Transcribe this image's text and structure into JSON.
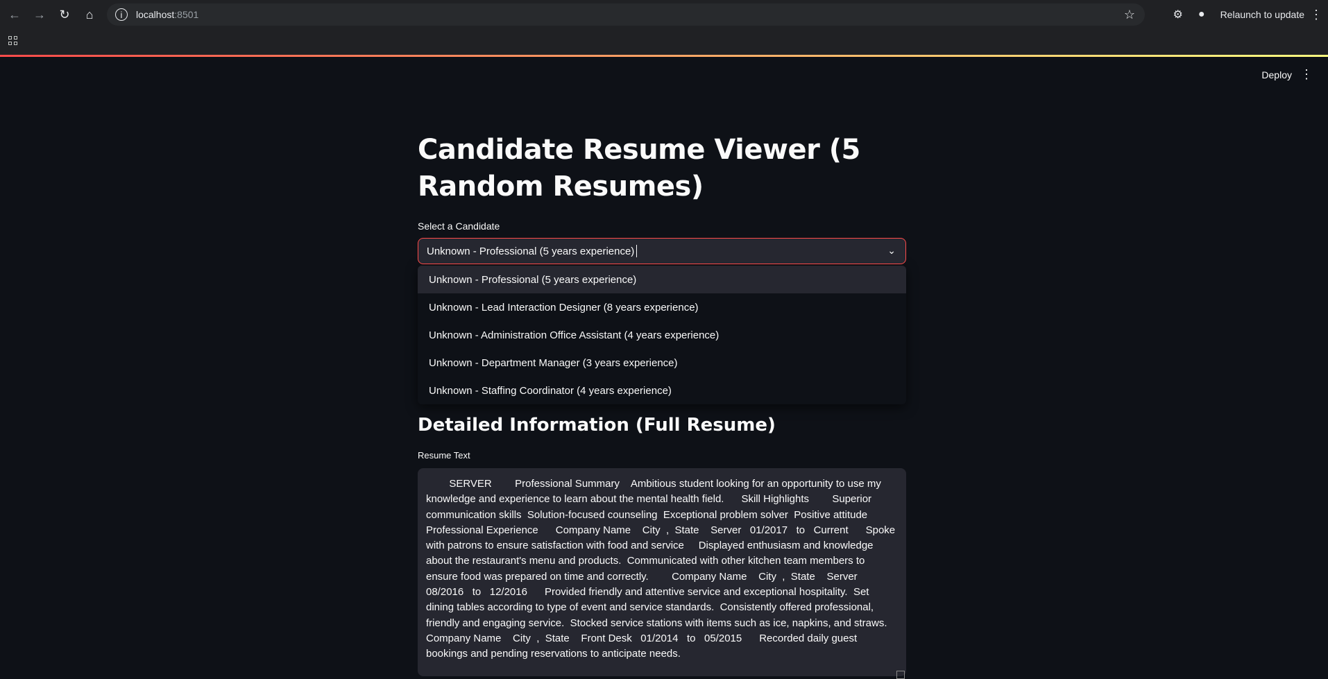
{
  "browser": {
    "url_host": "localhost",
    "url_port": ":8501",
    "relaunch_label": "Relaunch to update"
  },
  "app": {
    "deploy_label": "Deploy",
    "title": "Candidate Resume Viewer (5 Random Resumes)",
    "select_label": "Select a Candidate",
    "selected_value": "Unknown - Professional (5 years experience)",
    "options": [
      "Unknown - Professional (5 years experience)",
      "Unknown - Lead Interaction Designer (8 years experience)",
      "Unknown - Administration Office Assistant (4 years experience)",
      "Unknown - Department Manager (3 years experience)",
      "Unknown - Staffing Coordinator (4 years experience)"
    ],
    "section_heading": "Detailed Information (Full Resume)",
    "resume_label": "Resume Text",
    "resume_text": "        SERVER        Professional Summary    Ambitious student looking for an opportunity to use my knowledge and experience to learn about the mental health field.      Skill Highlights        Superior communication skills  Solution-focused counseling  Exceptional problem solver  Positive attitude              Professional Experience      Company Name    City  ,  State    Server   01/2017   to   Current      Spoke with patrons to ensure satisfaction with food and service     Displayed enthusiasm and knowledge about the restaurant's menu and products.  Communicated with other kitchen team members to ensure food was prepared on time and correctly.        Company Name    City  ,  State    Server   08/2016   to   12/2016      Provided friendly and attentive service and exceptional hospitality.  Set dining tables according to type of event and service standards.  Consistently offered professional, friendly and engaging service.  Stocked service stations with items such as ice, napkins, and straws.        Company Name    City  ,  State    Front Desk   01/2014   to   05/2015      Recorded daily guest bookings and pending reservations to anticipate needs."
  }
}
